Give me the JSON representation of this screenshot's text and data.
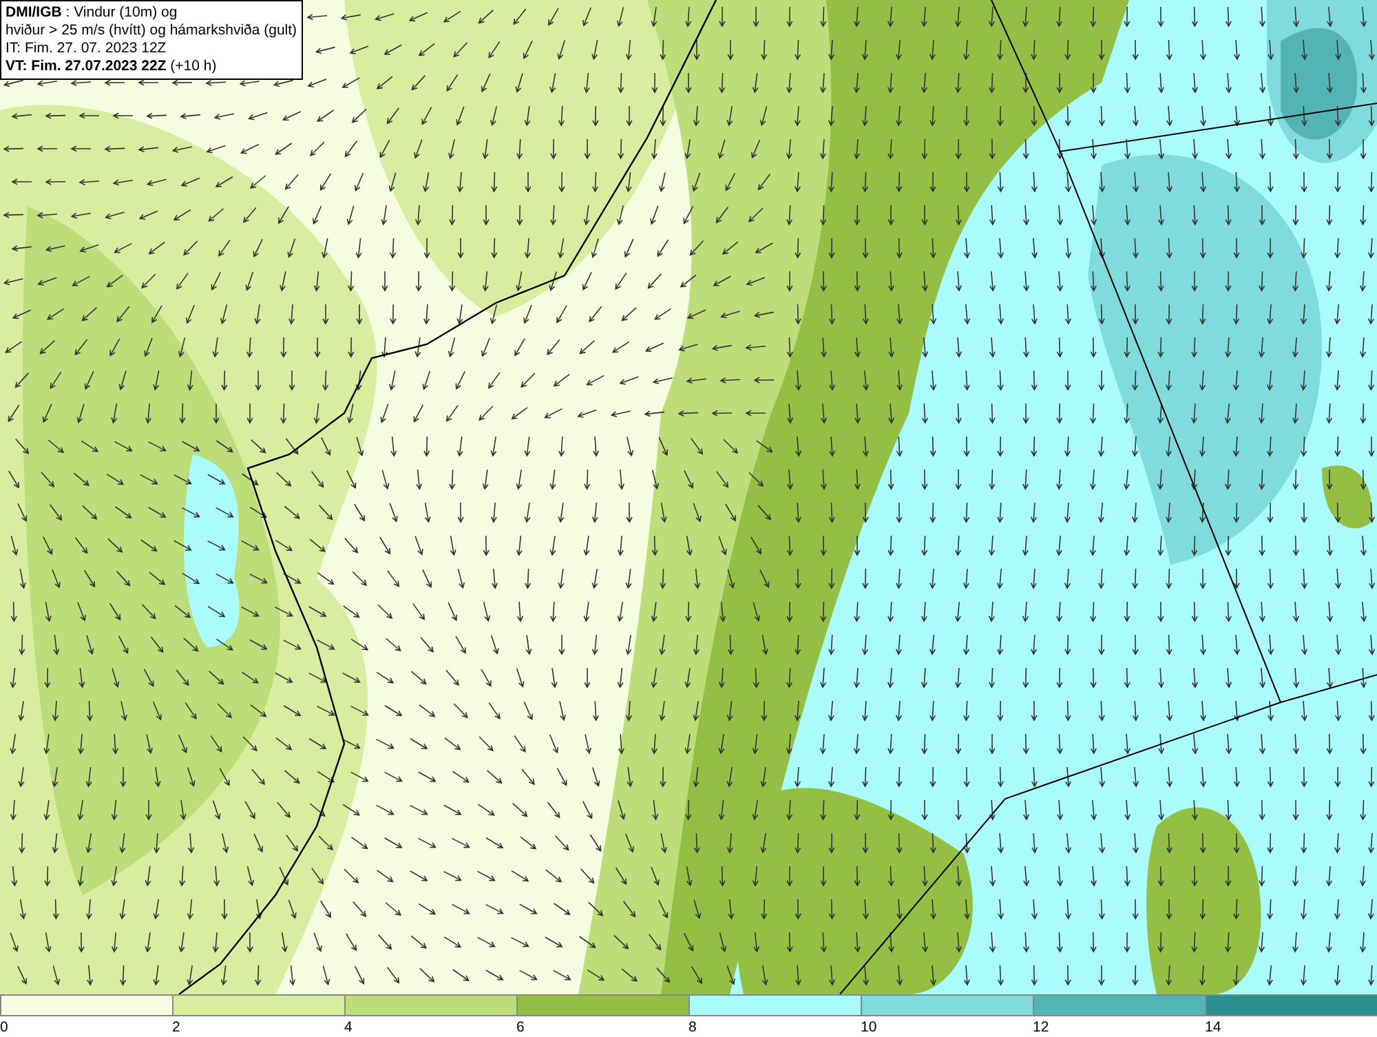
{
  "info_box": {
    "lines": [
      "**DMI/IGB** : Vindur (10m) og",
      "hviður > 25 m/s (hvítt) og hámarkshviða (gult)",
      "IT: Fim. 27. 07. 2023 12Z",
      "**VT: Fim. 27.07.2023 22Z** (+10 h)"
    ]
  },
  "legend": {
    "bins": [
      {
        "label": "0",
        "color": "#f5fce0"
      },
      {
        "label": "2",
        "color": "#d8eda0"
      },
      {
        "label": "4",
        "color": "#bcdd7a"
      },
      {
        "label": "6",
        "color": "#94bf45"
      },
      {
        "label": "8",
        "color": "#aafcfc"
      },
      {
        "label": "10",
        "color": "#80dcdc"
      },
      {
        "label": "12",
        "color": "#52b4b4"
      },
      {
        "label": "14",
        "color": "#2a9090"
      }
    ]
  }
}
